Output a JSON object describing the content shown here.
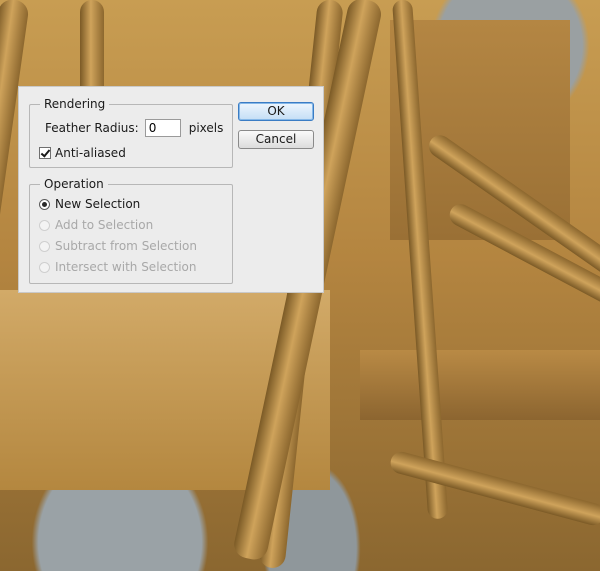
{
  "dialog": {
    "rendering": {
      "title": "Rendering",
      "feather_label": "Feather Radius:",
      "feather_value": "0",
      "feather_unit": "pixels",
      "antialiased_label": "Anti-aliased",
      "antialiased_checked": true
    },
    "operation": {
      "title": "Operation",
      "options": [
        {
          "label": "New Selection",
          "selected": true,
          "enabled": true
        },
        {
          "label": "Add to Selection",
          "selected": false,
          "enabled": false
        },
        {
          "label": "Subtract from Selection",
          "selected": false,
          "enabled": false
        },
        {
          "label": "Intersect with Selection",
          "selected": false,
          "enabled": false
        }
      ]
    },
    "buttons": {
      "ok": "OK",
      "cancel": "Cancel"
    }
  }
}
